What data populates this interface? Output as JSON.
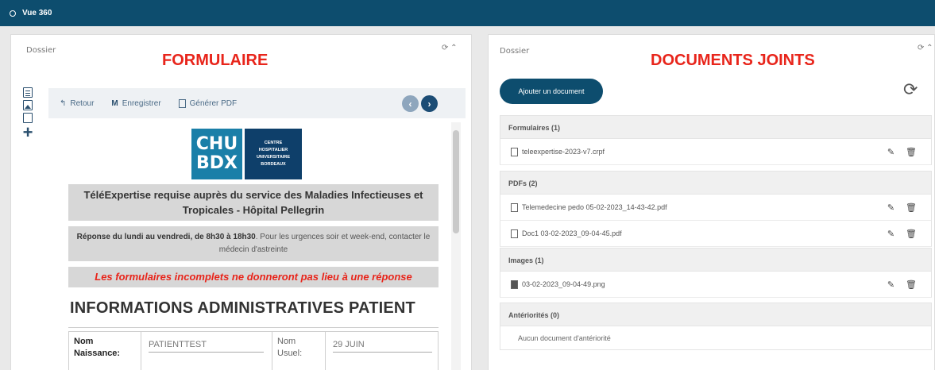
{
  "topbar": {
    "title": "Vue 360"
  },
  "left_panel": {
    "label": "Dossier",
    "heading": "FORMULAIRE",
    "tools": "⟳ ⌃",
    "toolbar": {
      "back": "Retour",
      "save": "Enregistrer",
      "pdf": "Générer PDF",
      "prev": "‹",
      "next": "›"
    },
    "logo": {
      "line1": "CHU",
      "line2": "BDX",
      "sub": [
        "CENTRE",
        "HOSPITALIER",
        "UNIVERSITAIRE",
        "BORDEAUX"
      ]
    },
    "box1": "TéléExpertise requise auprès du service des Maladies Infectieuses et Tropicales - Hôpital Pellegrin",
    "box2_bold": "Réponse du lundi au vendredi, de 8h30 à 18h30",
    "box2_rest": ". Pour les urgences soir et week-end, contacter le médecin d'astreinte",
    "box3": "Les formulaires incomplets ne donneront pas lieu à une réponse",
    "section_title": "INFORMATIONS ADMINISTRATIVES PATIENT",
    "fields": {
      "nom_naissance_label": "Nom Naissance:",
      "nom_naissance_value": "PATIENTTEST",
      "nom_usuel_label": "Nom Usuel:",
      "nom_usuel_value": "29 JUIN"
    }
  },
  "right_panel": {
    "label": "Dossier",
    "heading": "DOCUMENTS JOINTS",
    "tools": "⟳ ⌃",
    "add_button": "Ajouter un document",
    "sections": [
      {
        "title": "Formulaires (1)",
        "docs": [
          "teleexpertise-2023-v7.crpf"
        ]
      },
      {
        "title": "PDFs (2)",
        "docs": [
          "Telemedecine pedo 05-02-2023_14-43-42.pdf",
          "Doc1 03-02-2023_09-04-45.pdf"
        ]
      },
      {
        "title": "Images (1)",
        "docs": [
          "03-02-2023_09-04-49.png"
        ]
      },
      {
        "title": "Antériorités (0)",
        "empty": "Aucun document d'antériorité"
      }
    ]
  }
}
